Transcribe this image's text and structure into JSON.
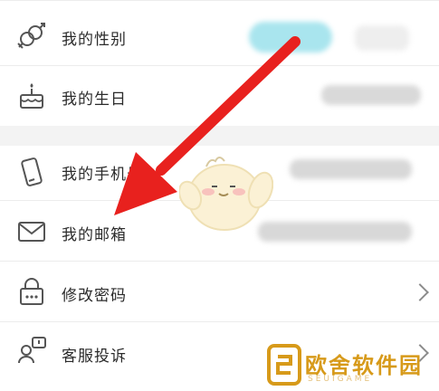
{
  "settings": {
    "items": [
      {
        "label": "我的性别",
        "icon": "gender-icon"
      },
      {
        "label": "我的生日",
        "icon": "birthday-cake-icon"
      },
      {
        "label": "我的手机号",
        "icon": "phone-icon"
      },
      {
        "label": "我的邮箱",
        "icon": "mail-icon"
      },
      {
        "label": "修改密码",
        "icon": "lock-icon",
        "chevron": true
      },
      {
        "label": "客服投诉",
        "icon": "service-complaint-icon",
        "chevron": true
      }
    ]
  },
  "colors": {
    "arrow": "#e8211e",
    "pill": "#9fe2ec",
    "watermark_text": "#d79a1a"
  },
  "watermark": {
    "text": "欧舍软件园",
    "sub": "SEUIGAME"
  }
}
